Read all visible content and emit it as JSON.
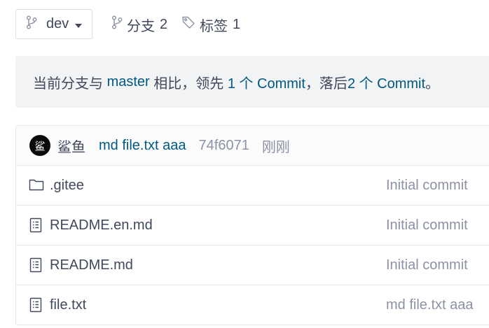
{
  "toolbar": {
    "branch_selector": {
      "label": "dev",
      "icon": "branch-icon"
    },
    "branches": {
      "label": "分支",
      "count": "2",
      "icon": "branch-icon"
    },
    "tags": {
      "label": "标签",
      "count": "1",
      "icon": "tag-icon"
    }
  },
  "compare_banner": {
    "prefix": "当前分支与 ",
    "base_branch": "master",
    "middle1": " 相比，领先 ",
    "ahead": "1 个 Commit",
    "middle2": "，落后 ",
    "behind": "2 个 Commit",
    "suffix": "。"
  },
  "latest_commit": {
    "avatar_text": "鲨",
    "author": "鲨鱼",
    "message": "md file.txt aaa",
    "sha": "74f6071",
    "time": "刚刚"
  },
  "files": [
    {
      "name": ".gitee",
      "type": "folder",
      "icon": "folder-icon",
      "last_commit": "Initial commit"
    },
    {
      "name": "README.en.md",
      "type": "file",
      "icon": "file-text-icon",
      "last_commit": "Initial commit"
    },
    {
      "name": "README.md",
      "type": "file",
      "icon": "file-text-icon",
      "last_commit": "Initial commit"
    },
    {
      "name": "file.txt",
      "type": "file",
      "icon": "file-text-icon",
      "last_commit": "md file.txt aaa"
    }
  ],
  "colors": {
    "text": "#40485b",
    "link": "#005980",
    "muted": "#8c92a4",
    "banner_bg": "#f1f3f5",
    "border": "#e3e5e8"
  }
}
